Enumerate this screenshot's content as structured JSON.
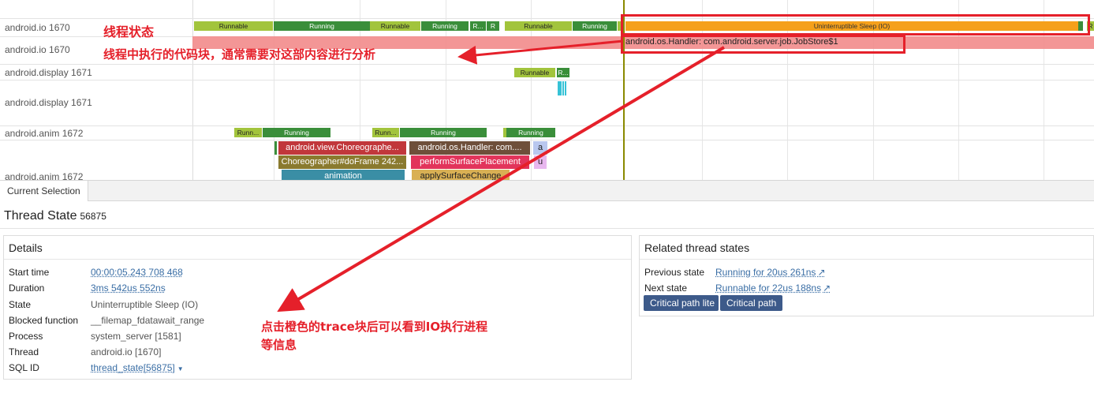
{
  "tracks": [
    {
      "label": "android.io 1670"
    },
    {
      "label": "android.io 1670"
    },
    {
      "label": "android.display 1671"
    },
    {
      "label": "android.display 1671"
    },
    {
      "label": "android.anim 1672"
    },
    {
      "label": "android.anim 1672"
    }
  ],
  "thread_states": {
    "io_runnable1": "Runnable",
    "io_running1": "Running",
    "io_runnable2": "Runnable",
    "io_running2": "Running",
    "io_r1": "R...",
    "io_r2": "R",
    "io_runnable3": "Runnable",
    "io_running3": "Running",
    "io_sleep": "Uninterruptible Sleep (IO)",
    "io_r_end": "R",
    "display_runnable": "Runnable",
    "display_r": "R...",
    "anim_runn1": "Runn...",
    "anim_running1": "Running",
    "anim_runn2": "Runn...",
    "anim_running2": "Running",
    "anim_running3": "Running"
  },
  "slices": {
    "handler_slice": "android.os.Handler: com.android.server.job.JobStore$1",
    "anim_choreographer": "android.view.Choreographe...",
    "anim_handler": "android.os.Handler: com....",
    "anim_a": "a",
    "anim_doframe": "Choreographer#doFrame 242...",
    "anim_perform": "performSurfacePlacement",
    "anim_u": "u",
    "anim_animation": "animation",
    "anim_apply": "applySurfaceChange"
  },
  "annotations": {
    "thread_state": "线程状态",
    "code_block": "线程中执行的代码块，通常需要对这部内容进行分析",
    "click_hint_line1": "点击橙色的trace块后可以看到IO执行进程",
    "click_hint_line2": "等信息"
  },
  "tab": {
    "label": "Current Selection"
  },
  "title": {
    "main": "Thread State",
    "id": "56875"
  },
  "details": {
    "header": "Details",
    "rows": [
      {
        "key": "Start time",
        "value": "00:00:05.243 708 468"
      },
      {
        "key": "Duration",
        "value": "3ms 542us 552ns"
      },
      {
        "key": "State",
        "value": "Uninterruptible Sleep (IO)"
      },
      {
        "key": "Blocked function",
        "value": "__filemap_fdatawait_range"
      },
      {
        "key": "Process",
        "value": "system_server [1581]"
      },
      {
        "key": "Thread",
        "value": "android.io [1670]"
      },
      {
        "key": "SQL ID",
        "value": "thread_state[56875]"
      }
    ]
  },
  "related": {
    "header": "Related thread states",
    "previous_label": "Previous state",
    "previous_value": "Running for 20us 261ns",
    "next_label": "Next state",
    "next_value": "Runnable for 22us 188ns",
    "btn_lite": "Critical path lite",
    "btn_full": "Critical path"
  },
  "colors": {
    "runnable": "#a2c43c",
    "running": "#3a8e3a",
    "sleep": "#f5a01b",
    "annotation": "#e5202a",
    "button": "#3d5a8a"
  }
}
